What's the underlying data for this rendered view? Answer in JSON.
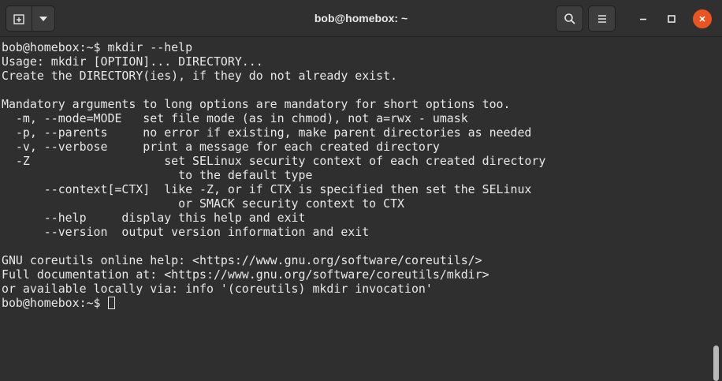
{
  "window": {
    "title": "bob@homebox: ~"
  },
  "titlebar": {
    "new_tab_icon": "new-tab-icon",
    "menu_icon": "chevron-down-icon",
    "search_icon": "search-icon",
    "hamburger_icon": "hamburger-menu-icon",
    "minimize_icon": "minimize-icon",
    "maximize_icon": "maximize-icon",
    "close_icon": "close-icon"
  },
  "colors": {
    "background": "#2f2f2f",
    "text": "#e8e8e8",
    "close_button": "#e95420"
  },
  "terminal": {
    "lines": [
      "bob@homebox:~$ mkdir --help",
      "Usage: mkdir [OPTION]... DIRECTORY...",
      "Create the DIRECTORY(ies), if they do not already exist.",
      "",
      "Mandatory arguments to long options are mandatory for short options too.",
      "  -m, --mode=MODE   set file mode (as in chmod), not a=rwx - umask",
      "  -p, --parents     no error if existing, make parent directories as needed",
      "  -v, --verbose     print a message for each created directory",
      "  -Z                   set SELinux security context of each created directory",
      "                         to the default type",
      "      --context[=CTX]  like -Z, or if CTX is specified then set the SELinux",
      "                         or SMACK security context to CTX",
      "      --help     display this help and exit",
      "      --version  output version information and exit",
      "",
      "GNU coreutils online help: <https://www.gnu.org/software/coreutils/>",
      "Full documentation at: <https://www.gnu.org/software/coreutils/mkdir>",
      "or available locally via: info '(coreutils) mkdir invocation'"
    ],
    "prompt": "bob@homebox:~$ "
  }
}
